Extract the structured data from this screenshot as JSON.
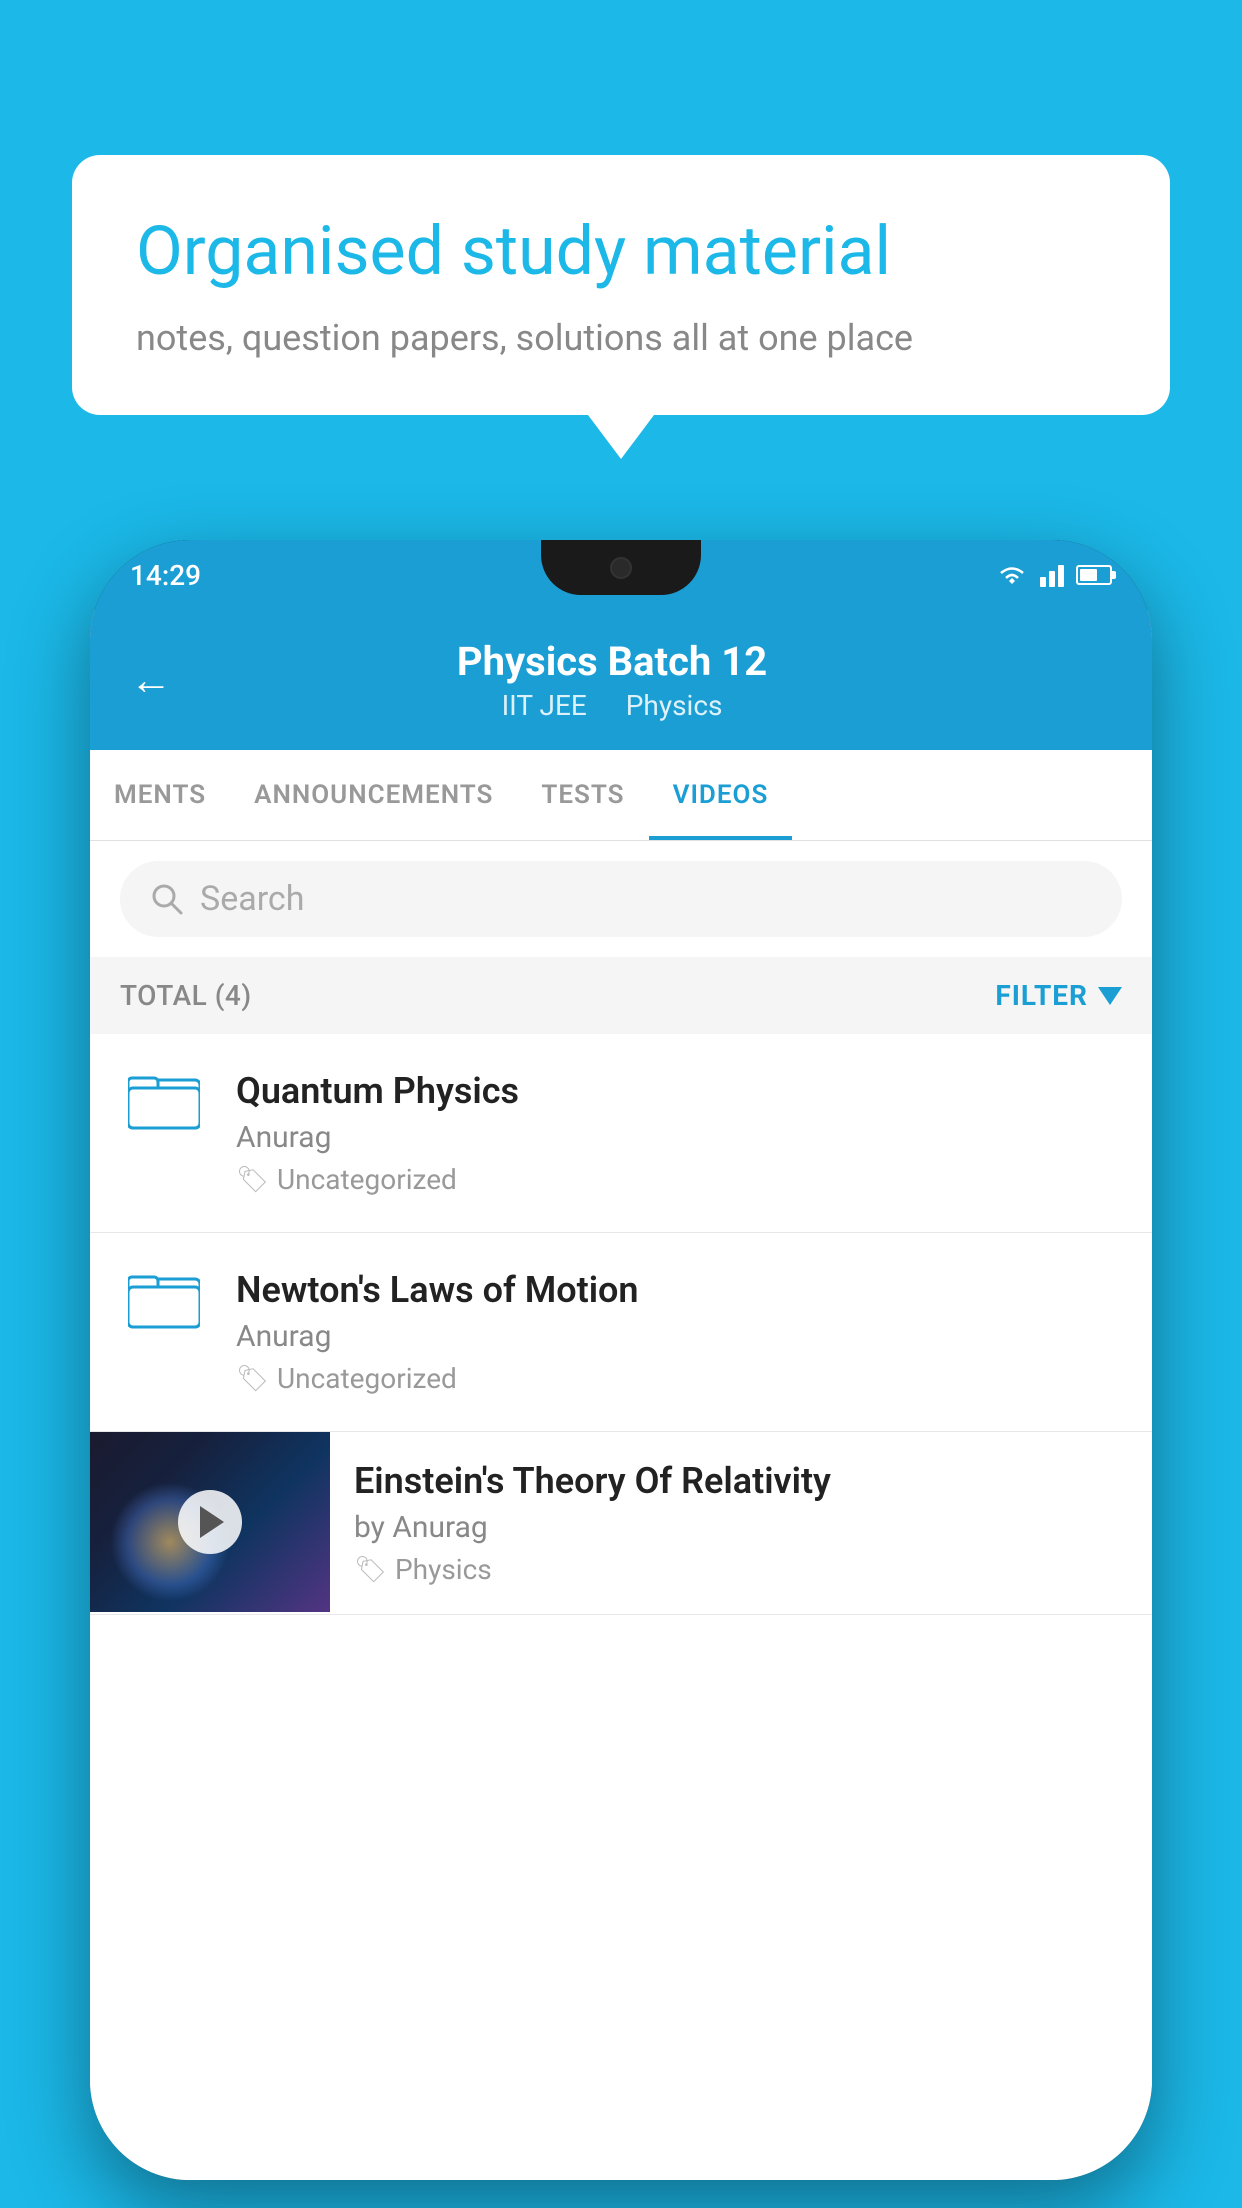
{
  "background_color": "#1bb8e8",
  "speech_bubble": {
    "title": "Organised study material",
    "subtitle": "notes, question papers, solutions all at one place"
  },
  "phone": {
    "status_bar": {
      "time": "14:29"
    },
    "header": {
      "title": "Physics Batch 12",
      "tag1": "IIT JEE",
      "tag2": "Physics",
      "back_label": "←"
    },
    "tabs": [
      {
        "label": "MENTS",
        "active": false
      },
      {
        "label": "ANNOUNCEMENTS",
        "active": false
      },
      {
        "label": "TESTS",
        "active": false
      },
      {
        "label": "VIDEOS",
        "active": true
      }
    ],
    "search": {
      "placeholder": "Search"
    },
    "filter": {
      "total_label": "TOTAL (4)",
      "filter_label": "FILTER"
    },
    "list_items": [
      {
        "title": "Quantum Physics",
        "author": "Anurag",
        "tag": "Uncategorized",
        "type": "folder"
      },
      {
        "title": "Newton's Laws of Motion",
        "author": "Anurag",
        "tag": "Uncategorized",
        "type": "folder"
      }
    ],
    "video_item": {
      "title": "Einstein's Theory Of Relativity",
      "author": "by Anurag",
      "tag": "Physics",
      "type": "video"
    }
  }
}
